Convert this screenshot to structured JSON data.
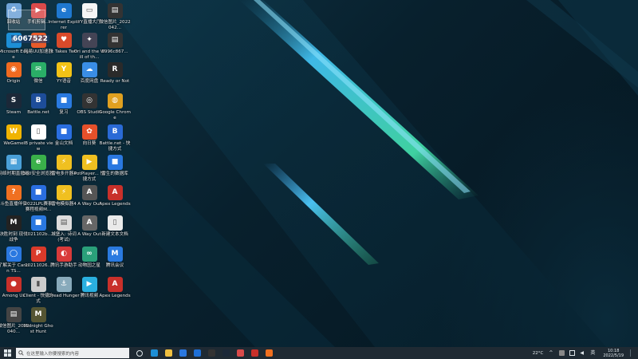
{
  "desktop": {
    "icons": [
      {
        "label": "回收站",
        "color": "#6fa3d8",
        "glyph": "♻"
      },
      {
        "label": "手机剪辑...",
        "color": "#d94a4a",
        "glyph": "▶"
      },
      {
        "label": "Internet Explorer",
        "color": "#1f78d0",
        "glyph": "e"
      },
      {
        "label": "YY直播大厅",
        "color": "#f5f5f5",
        "glyph": "▭"
      },
      {
        "label": "微信图片_2022042...",
        "color": "#333",
        "glyph": "▤"
      },
      {
        "label": "Microsoft Edge",
        "color": "#1d8fd6",
        "glyph": "e"
      },
      {
        "label": "网易UU加速器",
        "color": "#e85a2a",
        "glyph": "U"
      },
      {
        "label": "It Takes Two",
        "color": "#d94a2a",
        "glyph": "♥"
      },
      {
        "label": "Ori and the Will of th...",
        "color": "#445",
        "glyph": "✦"
      },
      {
        "label": "6996c867...",
        "color": "#333",
        "glyph": "▤"
      },
      {
        "label": "Origin",
        "color": "#f06a20",
        "glyph": "◉"
      },
      {
        "label": "微信",
        "color": "#2aae67",
        "glyph": "✉"
      },
      {
        "label": "YY语音",
        "color": "#f3c316",
        "glyph": "Y"
      },
      {
        "label": "百度网盘",
        "color": "#3a8ee6",
        "glyph": "☁"
      },
      {
        "label": "Ready or Not",
        "color": "#2a2a2a",
        "glyph": "R"
      },
      {
        "label": "Steam",
        "color": "#1b2838",
        "glyph": "S"
      },
      {
        "label": "Battle.net",
        "color": "#1d4d9a",
        "glyph": "B"
      },
      {
        "label": "复习",
        "color": "#2a7ae0",
        "glyph": "■"
      },
      {
        "label": "OBS Studio",
        "color": "#333",
        "glyph": "◎"
      },
      {
        "label": "Google Chrome",
        "color": "#e0a020",
        "glyph": "◍"
      },
      {
        "label": "WeGame",
        "color": "#f0b400",
        "glyph": "W"
      },
      {
        "label": "IB private view",
        "color": "#ffffff",
        "glyph": "▯"
      },
      {
        "label": "金山文档",
        "color": "#2a6ee0",
        "glyph": "■"
      },
      {
        "label": "向日葵",
        "color": "#e6502a",
        "glyph": "✿"
      },
      {
        "label": "Battle.net - 快捷方式",
        "color": "#2a6ad6",
        "glyph": "B"
      },
      {
        "label": "网络时期直播组",
        "color": "#4aa0d8",
        "glyph": "▦"
      },
      {
        "label": "360安全浏览器",
        "color": "#3ab04a",
        "glyph": "e"
      },
      {
        "label": "雷电多开器4",
        "color": "#f0c020",
        "glyph": "⚡"
      },
      {
        "label": "PotPlayer... 快捷方式",
        "color": "#f0c020",
        "glyph": "▶"
      },
      {
        "label": "雷生的数据库",
        "color": "#2a78e0",
        "glyph": "■"
      },
      {
        "label": "斗鱼直播伴侣",
        "color": "#f07020",
        "glyph": "?"
      },
      {
        "label": "2022LPL赛事 赛程视频M...",
        "color": "#2a6ee0",
        "glyph": "■"
      },
      {
        "label": "雷电模拟器4",
        "color": "#f0c020",
        "glyph": "⚡"
      },
      {
        "label": "A Way Out",
        "color": "#555",
        "glyph": "A"
      },
      {
        "label": "Apex Legends",
        "color": "#c8302a",
        "glyph": "A"
      },
      {
        "label": "决胜时刻 现代战争",
        "color": "#222",
        "glyph": "M"
      },
      {
        "label": "2021102b...",
        "color": "#2a78e0",
        "glyph": "■"
      },
      {
        "label": "城堡入: 诗词 (考试)",
        "color": "#ddd",
        "glyph": "▤"
      },
      {
        "label": "A Way Out",
        "color": "#666",
        "glyph": "A"
      },
      {
        "label": "新建文本文档",
        "color": "#eaeaea",
        "glyph": "▯"
      },
      {
        "label": "了解关于 Canon TS...",
        "color": "#2a78e0",
        "glyph": "◯"
      },
      {
        "label": "20211026...",
        "color": "#d93a2a",
        "glyph": "P"
      },
      {
        "label": "腾讯手游助手",
        "color": "#d93a3a",
        "glyph": "◐"
      },
      {
        "label": "动物园之星",
        "color": "#2aa07a",
        "glyph": "∞"
      },
      {
        "label": "腾讯会议",
        "color": "#2a7ae0",
        "glyph": "M"
      },
      {
        "label": "Among Us",
        "color": "#c8302a",
        "glyph": "●"
      },
      {
        "label": "Client - 快捷方式",
        "color": "#ccc",
        "glyph": "▮"
      },
      {
        "label": "Dread Hunger",
        "color": "#8ab",
        "glyph": "⚓"
      },
      {
        "label": "腾讯视频",
        "color": "#2ab0e0",
        "glyph": "▶"
      },
      {
        "label": "Apex Legends",
        "color": "#c8302a",
        "glyph": "A"
      },
      {
        "label": "微信图片_2022040...",
        "color": "#444",
        "glyph": "▤"
      },
      {
        "label": "Midnight Ghost Hunt",
        "color": "#553",
        "glyph": "M"
      }
    ],
    "overlay_number": "6067522"
  },
  "taskbar": {
    "search_placeholder": "在这里输入你要搜索的内容",
    "apps": [
      {
        "name": "task-view",
        "color": "#dfe6ea"
      },
      {
        "name": "edge",
        "color": "#1d8fd6"
      },
      {
        "name": "file-explorer",
        "color": "#f0c040"
      },
      {
        "name": "store",
        "color": "#2a78e0"
      },
      {
        "name": "mail",
        "color": "#1d6fd6"
      },
      {
        "name": "terminal",
        "color": "#333"
      },
      {
        "name": "steam",
        "color": "#1b2838"
      },
      {
        "name": "game-app",
        "color": "#d94a4a"
      },
      {
        "name": "acrobat",
        "color": "#c8302a"
      },
      {
        "name": "orange-app",
        "color": "#f07020"
      }
    ],
    "weather": "22°C",
    "clock_time": "10:18",
    "clock_date": "2022/5/19"
  }
}
